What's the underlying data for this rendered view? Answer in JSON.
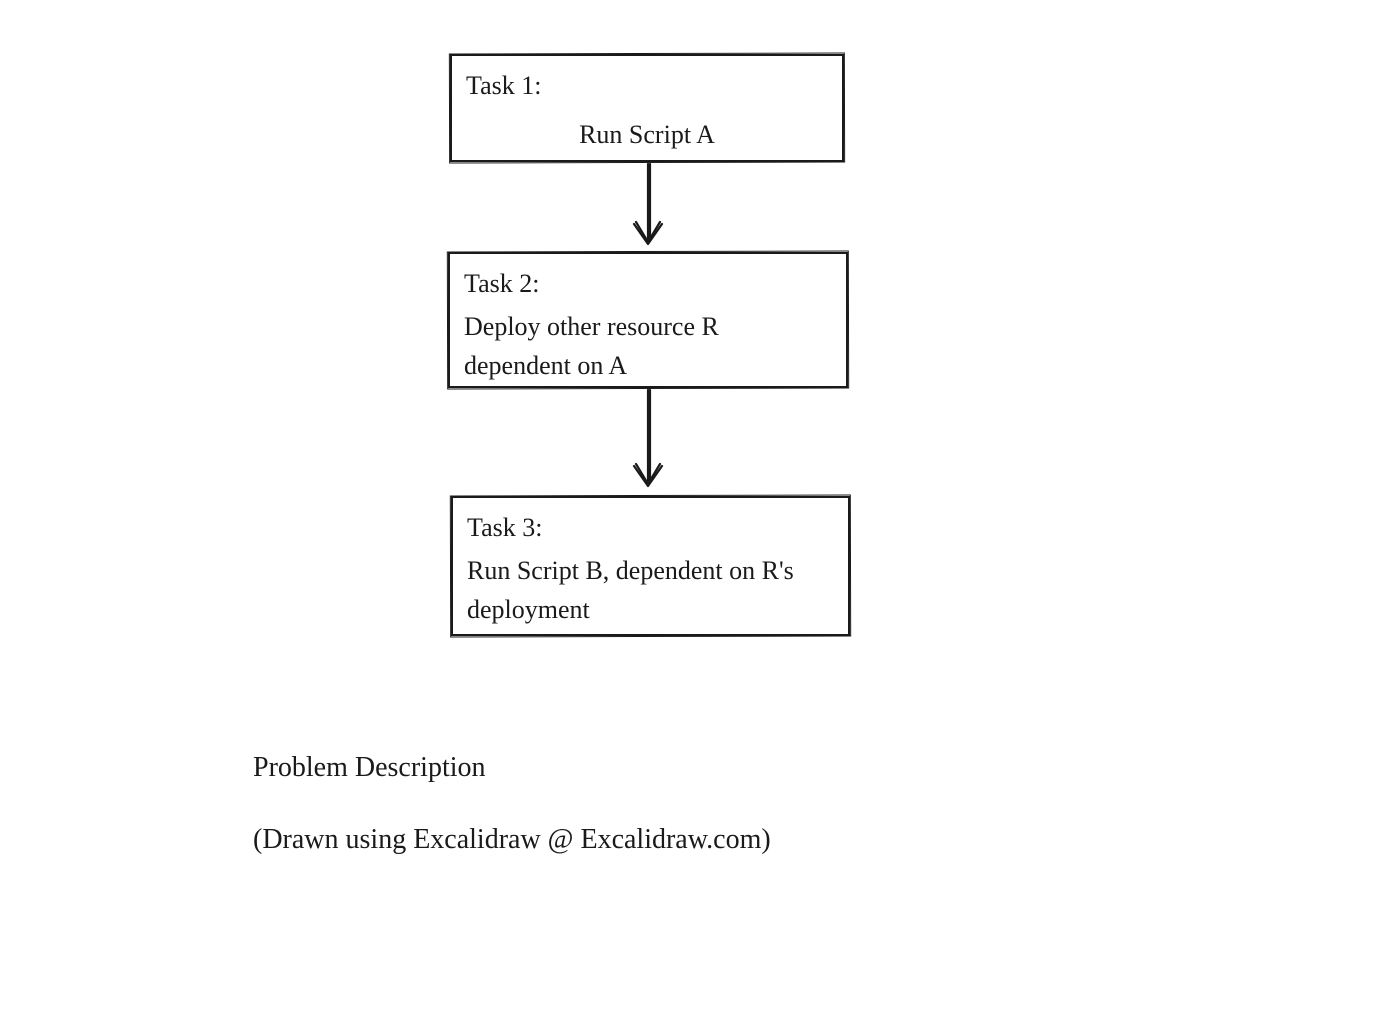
{
  "nodes": {
    "task1": {
      "title": "Task 1:",
      "body": "Run Script A"
    },
    "task2": {
      "title": "Task 2:",
      "body": "Deploy other resource R dependent on A"
    },
    "task3": {
      "title": "Task 3:",
      "body": "Run Script B, dependent on R's deployment"
    }
  },
  "captions": {
    "title": "Problem Description",
    "credit": "(Drawn using Excalidraw @ Excalidraw.com)"
  }
}
